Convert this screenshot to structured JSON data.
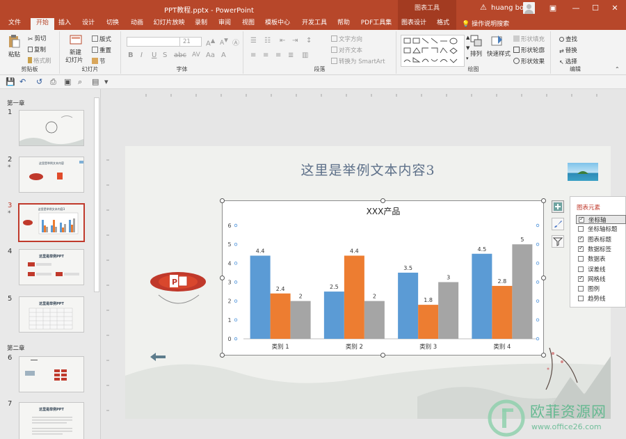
{
  "app": {
    "doc_title": "PPT教程.pptx  -  PowerPoint",
    "context_tool": "图表工具",
    "user": "huang bo",
    "tell_me": "操作说明搜索"
  },
  "tabs": [
    {
      "label": "文件"
    },
    {
      "label": "开始"
    },
    {
      "label": "插入"
    },
    {
      "label": "设计"
    },
    {
      "label": "切换"
    },
    {
      "label": "动画"
    },
    {
      "label": "幻灯片放映"
    },
    {
      "label": "录制"
    },
    {
      "label": "审阅"
    },
    {
      "label": "视图"
    },
    {
      "label": "模板中心"
    },
    {
      "label": "开发工具"
    },
    {
      "label": "帮助"
    },
    {
      "label": "PDF工具集"
    },
    {
      "label": "图表设计"
    },
    {
      "label": "格式"
    }
  ],
  "ribbon": {
    "clipboard": {
      "paste": "粘贴",
      "cut": "剪切",
      "copy": "复制",
      "painter": "格式刷",
      "label": "剪贴板"
    },
    "slides": {
      "new_slide_1": "新建",
      "new_slide_2": "幻灯片",
      "layout": "版式",
      "reset": "重置",
      "section": "节",
      "label": "幻灯片"
    },
    "font": {
      "size": "21",
      "label": "字体"
    },
    "paragraph": {
      "text_direction": "文字方向",
      "align_text": "对齐文本",
      "smartart": "转换为 SmartArt",
      "label": "段落"
    },
    "drawing": {
      "arrange": "排列",
      "quick_styles": "快速样式",
      "shape_fill": "形状填充",
      "shape_outline": "形状轮廓",
      "shape_effects": "形状效果",
      "label": "绘图"
    },
    "editing": {
      "find": "查找",
      "replace": "替换",
      "select": "选择",
      "label": "编辑"
    }
  },
  "sections": [
    {
      "label": "第一章"
    },
    {
      "label": "第二章"
    }
  ],
  "thumbnails": [
    {
      "num": "1",
      "star": "",
      "caption": ""
    },
    {
      "num": "2",
      "star": "*",
      "caption": "这里是举例文本内容"
    },
    {
      "num": "3",
      "star": "*",
      "caption": "这里是举例文本内容3"
    },
    {
      "num": "4",
      "star": "",
      "caption": "这里是举例PPT"
    },
    {
      "num": "5",
      "star": "",
      "caption": "这里是举例PPT"
    },
    {
      "num": "6",
      "star": "",
      "caption": ""
    },
    {
      "num": "7",
      "star": "",
      "caption": "这里是举例PPT"
    }
  ],
  "slide": {
    "title": "这里是举例文本内容3"
  },
  "chart_data": {
    "type": "bar",
    "title": "XXX产品",
    "categories": [
      "类别 1",
      "类别 2",
      "类别 3",
      "类别 4"
    ],
    "series": [
      {
        "values": [
          4.4,
          2.5,
          3.5,
          4.5
        ],
        "color": "#5b9bd5"
      },
      {
        "values": [
          2.4,
          4.4,
          1.8,
          2.8
        ],
        "color": "#ed7d31"
      },
      {
        "values": [
          2,
          2,
          3,
          5
        ],
        "color": "#a5a5a5"
      }
    ],
    "ylim": [
      0,
      6
    ],
    "yticks": [
      "0",
      "1",
      "2",
      "3",
      "4",
      "5",
      "6"
    ],
    "data_labels": true,
    "gridlines": false,
    "legend": "none"
  },
  "chart_elements": {
    "title": "图表元素",
    "items": [
      {
        "label": "坐标轴",
        "checked": true
      },
      {
        "label": "坐标轴标题",
        "checked": false
      },
      {
        "label": "图表标题",
        "checked": true
      },
      {
        "label": "数据标签",
        "checked": true
      },
      {
        "label": "数据表",
        "checked": false
      },
      {
        "label": "误差线",
        "checked": false
      },
      {
        "label": "网格线",
        "checked": true
      },
      {
        "label": "图例",
        "checked": false
      },
      {
        "label": "趋势线",
        "checked": false
      }
    ]
  },
  "watermark": {
    "main": "欧菲资源网",
    "url": "www.office26.com"
  }
}
